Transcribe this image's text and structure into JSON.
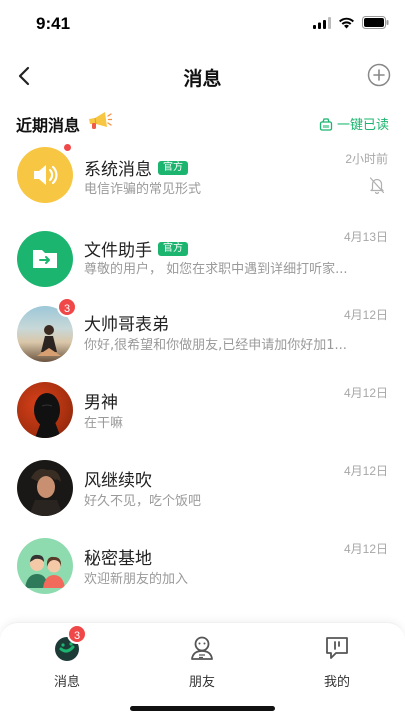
{
  "status_bar": {
    "time": "9:41"
  },
  "nav": {
    "title": "消息"
  },
  "section": {
    "title": "近期消息",
    "read_all": "一键已读"
  },
  "colors": {
    "accent": "#1bb56f",
    "badge": "#f04848",
    "system_avatar": "#f7c744",
    "file_avatar": "#1bb56f"
  },
  "messages": [
    {
      "name": "系统消息",
      "tag": "官方",
      "preview": "电信诈骗的常见形式",
      "time": "2小时前",
      "unread_dot": true,
      "muted": true,
      "avatar": "speaker-icon"
    },
    {
      "name": "文件助手",
      "tag": "官方",
      "preview": "尊敬的用户，  如您在求职中遇到详细打听家...",
      "time": "4月13日",
      "avatar": "folder-icon"
    },
    {
      "name": "大帅哥表弟",
      "preview": "你好,很希望和你做朋友,已经申请加你好加1...",
      "time": "4月12日",
      "unread_count": "3",
      "avatar": "photo-avatar"
    },
    {
      "name": "男神",
      "preview": "在干嘛",
      "time": "4月12日",
      "avatar": "photo-avatar"
    },
    {
      "name": "风继续吹",
      "preview": "好久不见，吃个饭吧",
      "time": "4月12日",
      "avatar": "photo-avatar"
    },
    {
      "name": "秘密基地",
      "preview": "欢迎新朋友的加入",
      "time": "4月12日",
      "avatar": "group-avatar"
    }
  ],
  "tabs": [
    {
      "label": "消息",
      "badge": "3",
      "icon": "chat-icon"
    },
    {
      "label": "朋友",
      "icon": "friends-icon"
    },
    {
      "label": "我的",
      "icon": "profile-icon"
    }
  ]
}
